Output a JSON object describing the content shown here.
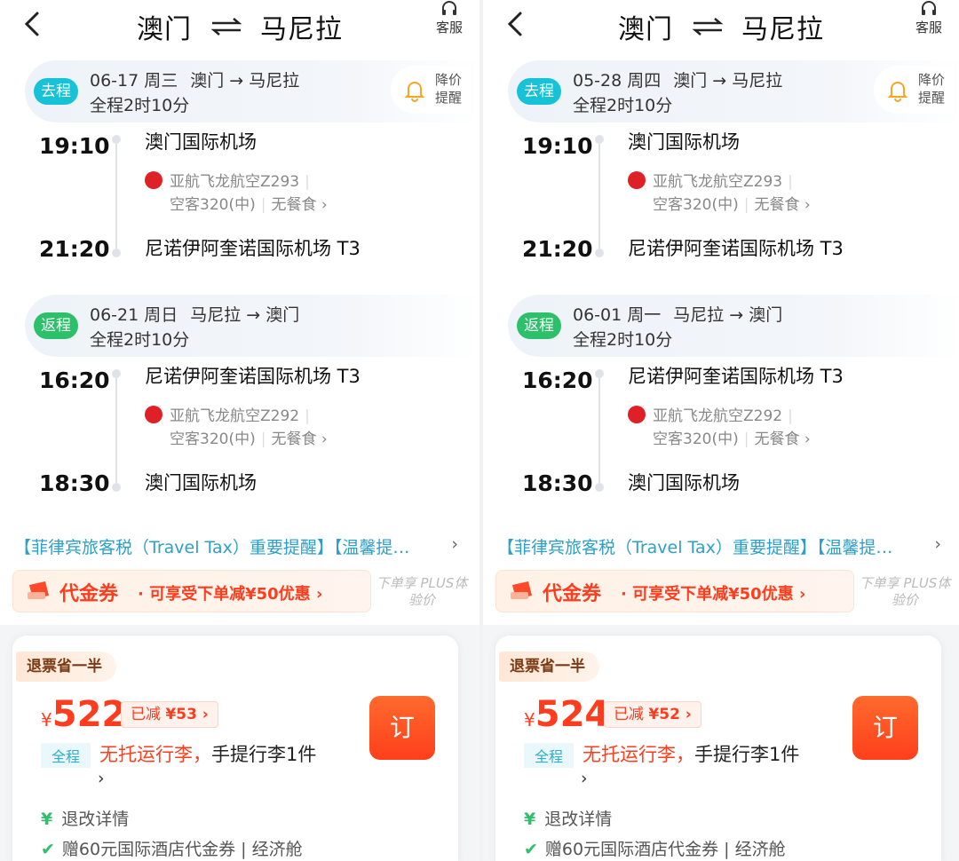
{
  "panels": [
    {
      "header": {
        "from": "澳门",
        "to": "马尼拉",
        "service": "客服"
      },
      "outbound": {
        "tag": "去程",
        "date": "06-17 周三",
        "route": "澳门 → 马尼拉",
        "duration": "全程2时10分",
        "dep_time": "19:10",
        "dep_airport": "澳门国际机场",
        "airline": "亚航飞龙航空Z293",
        "aircraft": "空客320(中)",
        "meal": "无餐食",
        "arr_time": "21:20",
        "arr_airport": "尼诺伊阿奎诺国际机场 T3"
      },
      "price_alert": "降价提醒",
      "return": {
        "tag": "返程",
        "date": "06-21 周日",
        "route": "马尼拉 → 澳门",
        "duration": "全程2时10分",
        "dep_time": "16:20",
        "dep_airport": "尼诺伊阿奎诺国际机场 T3",
        "airline": "亚航飞龙航空Z292",
        "aircraft": "空客320(中)",
        "meal": "无餐食",
        "arr_time": "18:30",
        "arr_airport": "澳门国际机场"
      },
      "notice": "【菲律宾旅客税（Travel Tax）重要提醒】【温馨提…",
      "voucher": {
        "title": "代金券",
        "desc": "· 可享受下单减¥50优惠 ›"
      },
      "plus": "下单享 PLUS体验价",
      "card": {
        "refund_badge": "退票省一半",
        "yen": "¥",
        "price": "522",
        "save": "已减",
        "save_amount": "¥53 ›",
        "book": "订",
        "trip_tag": "全程",
        "no_checked": "无托运行李，",
        "carry_on": "手提行李1件",
        "more": "›",
        "refund_info": "退改详情",
        "gift": "赠60元国际酒店代金券 | 经济舱"
      }
    },
    {
      "header": {
        "from": "澳门",
        "to": "马尼拉",
        "service": "客服"
      },
      "outbound": {
        "tag": "去程",
        "date": "05-28 周四",
        "route": "澳门 → 马尼拉",
        "duration": "全程2时10分",
        "dep_time": "19:10",
        "dep_airport": "澳门国际机场",
        "airline": "亚航飞龙航空Z293",
        "aircraft": "空客320(中)",
        "meal": "无餐食",
        "arr_time": "21:20",
        "arr_airport": "尼诺伊阿奎诺国际机场 T3"
      },
      "price_alert": "降价提醒",
      "return": {
        "tag": "返程",
        "date": "06-01 周一",
        "route": "马尼拉 → 澳门",
        "duration": "全程2时10分",
        "dep_time": "16:20",
        "dep_airport": "尼诺伊阿奎诺国际机场 T3",
        "airline": "亚航飞龙航空Z292",
        "aircraft": "空客320(中)",
        "meal": "无餐食",
        "arr_time": "18:30",
        "arr_airport": "澳门国际机场"
      },
      "notice": "【菲律宾旅客税（Travel Tax）重要提醒】【温馨提…",
      "voucher": {
        "title": "代金券",
        "desc": "· 可享受下单减¥50优惠 ›"
      },
      "plus": "下单享 PLUS体验价",
      "card": {
        "refund_badge": "退票省一半",
        "yen": "¥",
        "price": "524",
        "save": "已减",
        "save_amount": "¥52 ›",
        "book": "订",
        "trip_tag": "全程",
        "no_checked": "无托运行李，",
        "carry_on": "手提行李1件",
        "more": "›",
        "refund_info": "退改详情",
        "gift": "赠60元国际酒店代金券 | 经济舱"
      }
    }
  ],
  "icons": {
    "back": "back-arrow-icon",
    "swap": "swap-arrows-icon",
    "service": "headset-icon",
    "bell": "bell-icon",
    "airline": "airasia-logo-icon"
  },
  "colors": {
    "go_tag": "#16c3d6",
    "return_tag": "#2cc06a",
    "price": "#ff3d1e",
    "notice": "#2ca0c8"
  }
}
